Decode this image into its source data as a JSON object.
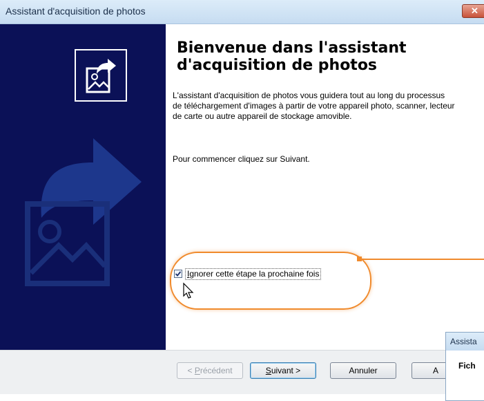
{
  "window": {
    "title": "Assistant d'acquisition de photos",
    "close_glyph": "✕"
  },
  "sidebar": {
    "accent_color": "#0b1157",
    "logo_icon": "photo-import-icon",
    "watermark_icon": "photo-import-icon"
  },
  "main": {
    "heading": "Bienvenue dans l'assistant d'acquisition de photos",
    "paragraph1": "L'assistant d'acquisition de photos vous guidera tout au long du processus de téléchargement d'images à partir de votre appareil photo, scanner, lecteur de carte ou autre appareil de stockage amovible.",
    "paragraph2": "Pour commencer cliquez sur Suivant.",
    "checkbox": {
      "label_first": "I",
      "label_rest": "gnorer cette étape la prochaine fois",
      "checked": true
    }
  },
  "buttons": {
    "back_label_pre": "< ",
    "back_label_u": "P",
    "back_label_post": "récédent",
    "next_label_u": "S",
    "next_label_post": "uivant >",
    "cancel_label": "Annuler",
    "partial_label": "A"
  },
  "overlay": {
    "title": "Assista",
    "text": "Fich"
  },
  "annotation": {
    "color": "#f08a2c"
  }
}
